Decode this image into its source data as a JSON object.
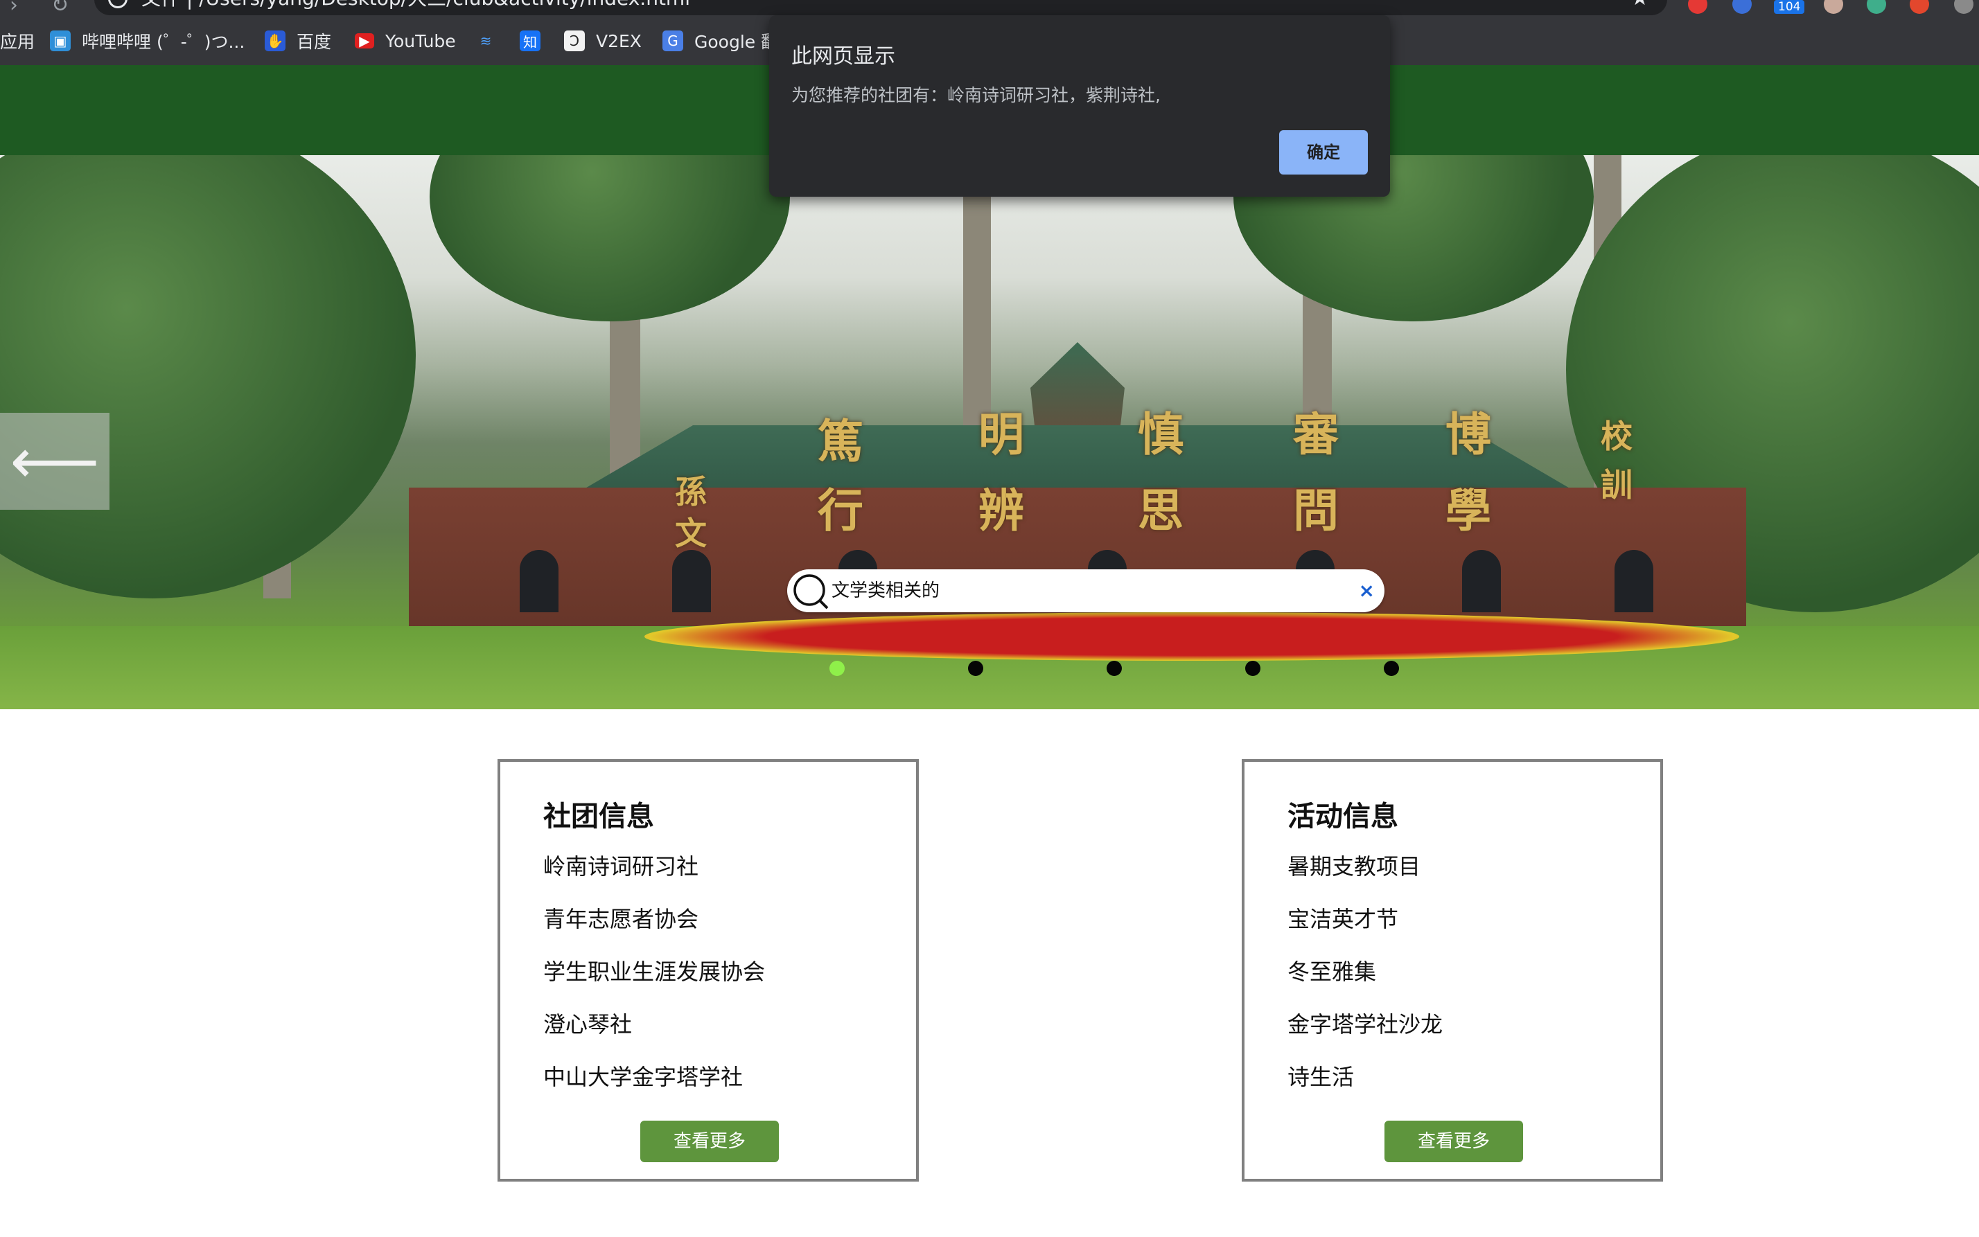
{
  "browser": {
    "address_text": "文件 | /Users/yang/Desktop/大三/club&activity/index.html",
    "bookmarks": [
      {
        "label": "应用",
        "icon": "apps-icon"
      },
      {
        "label": "哔哩哔哩 (゜-゜)つ...",
        "icon": "bilibili-icon"
      },
      {
        "label": "百度",
        "icon": "baidu-icon"
      },
      {
        "label": "YouTube",
        "icon": "youtube-icon"
      },
      {
        "label": "",
        "icon": "bird-icon"
      },
      {
        "label": "",
        "icon": "zhihu-icon"
      },
      {
        "label": "V2EX",
        "icon": "v2ex-icon"
      },
      {
        "label": "Google 翻",
        "icon": "google-translate-icon"
      }
    ],
    "extension_badge": "104",
    "colors": {
      "chrome": "#35363a",
      "header": "#1e5a22"
    }
  },
  "dialog": {
    "title": "此网页显示",
    "message": "为您推荐的社团有：岭南诗词研习社，紫荆诗社,",
    "ok_label": "确定"
  },
  "hero": {
    "calligraphy": [
      "篤",
      "行",
      "明",
      "辨",
      "慎",
      "思",
      "審",
      "問",
      "博",
      "學",
      "校",
      "訓",
      "孫",
      "文"
    ],
    "prev_arrow": "⟵",
    "search": {
      "value": "文学类相关的",
      "clear_label": "×"
    },
    "active_dot": 0,
    "dot_count": 5,
    "active_dot_color": "#8ff04a"
  },
  "clubs": {
    "title": "社团信息",
    "items": [
      "岭南诗词研习社",
      "青年志愿者协会",
      "学生职业生涯发展协会",
      "澄心琴社",
      "中山大学金字塔学社"
    ],
    "more_label": "查看更多"
  },
  "activities": {
    "title": "活动信息",
    "items": [
      "暑期支教项目",
      "宝洁英才节",
      "冬至雅集",
      "金字塔学社沙龙",
      "诗生活"
    ],
    "more_label": "查看更多"
  }
}
